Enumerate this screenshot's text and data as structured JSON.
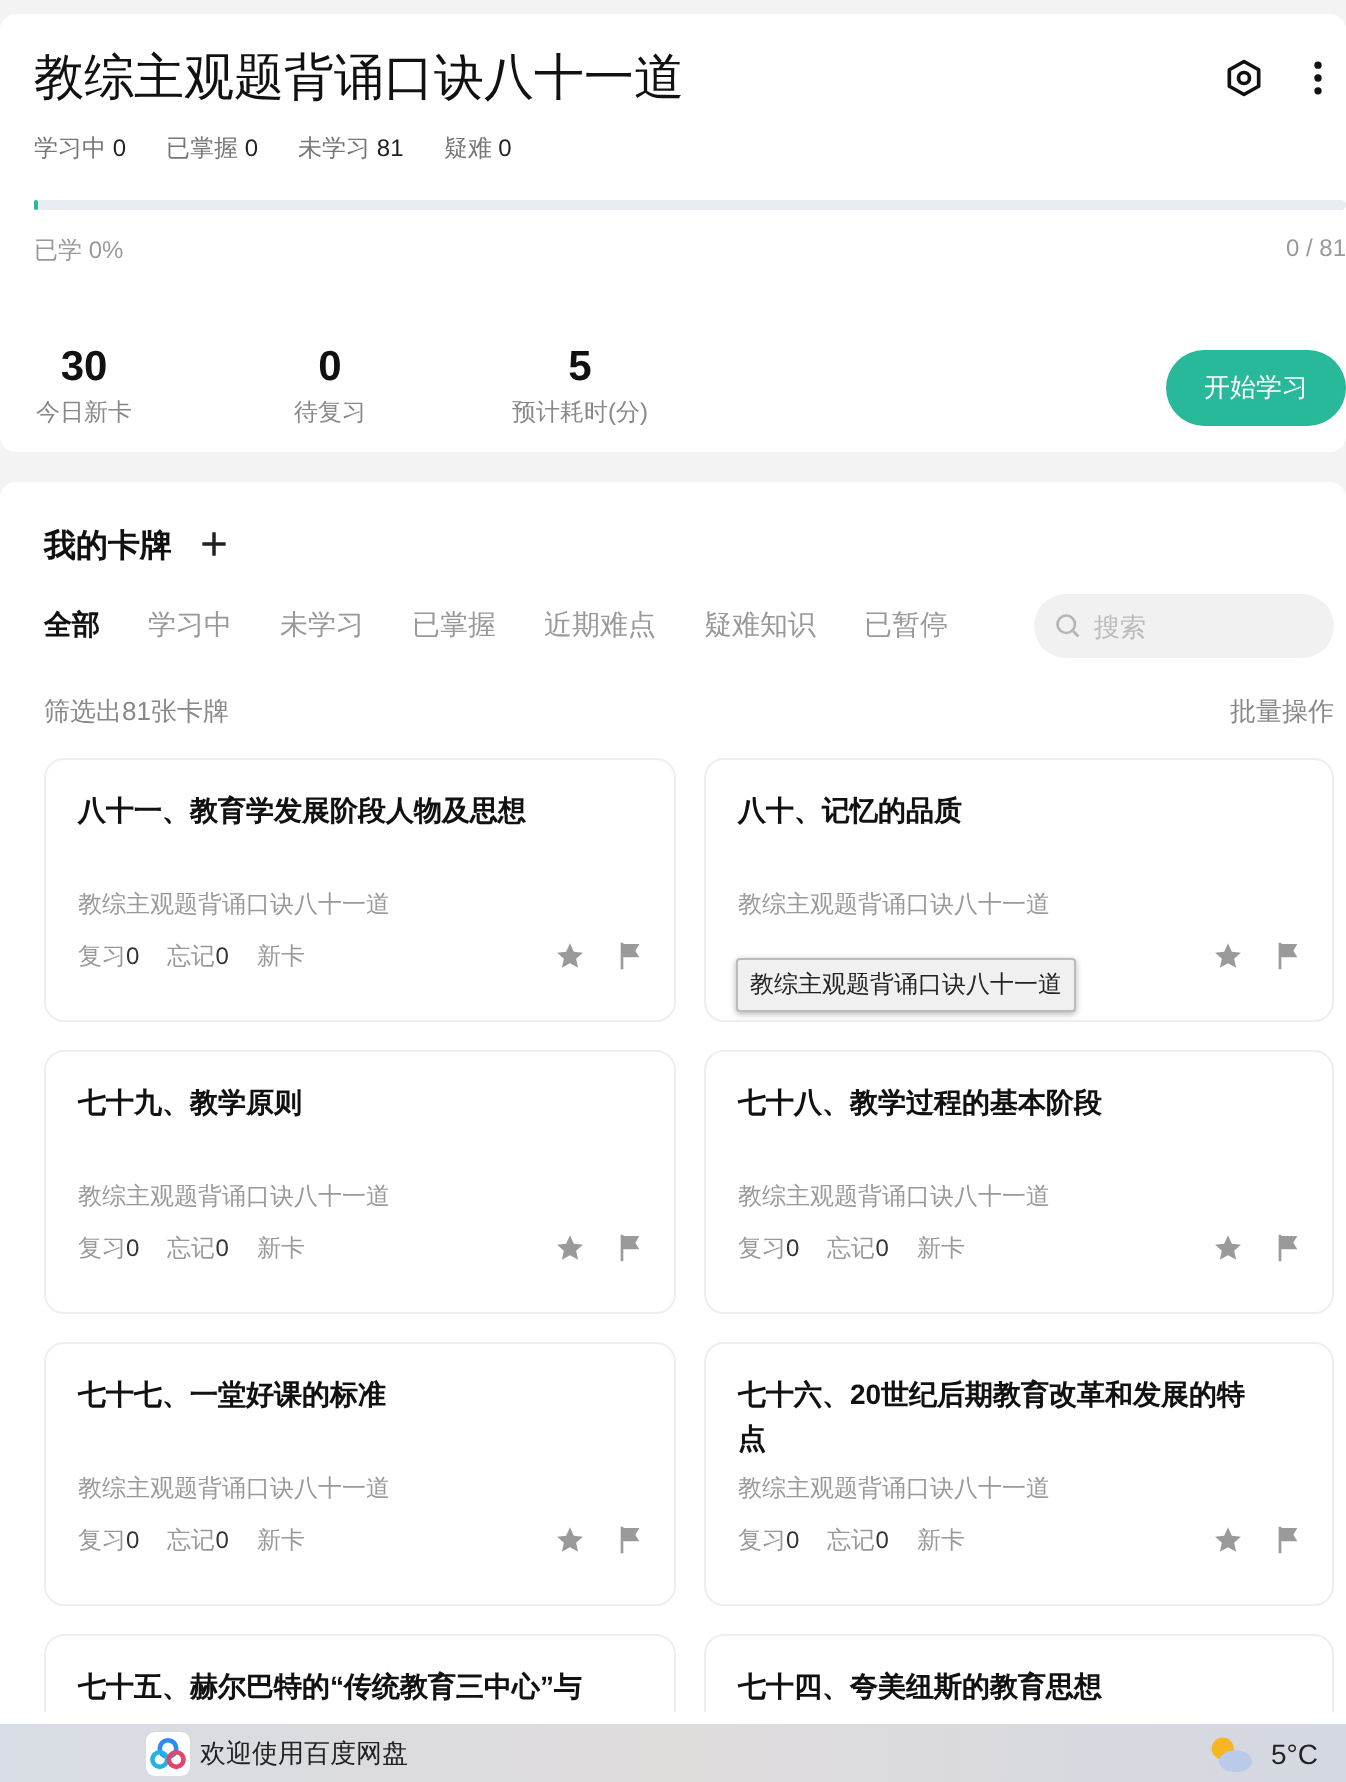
{
  "deck": {
    "title": "教综主观题背诵口诀八十一道",
    "counts": [
      {
        "label": "学习中",
        "value": "0"
      },
      {
        "label": "已掌握",
        "value": "0"
      },
      {
        "label": "未学习",
        "value": "81"
      },
      {
        "label": "疑难",
        "value": "0"
      }
    ],
    "progress": {
      "level": 0,
      "caption": "已学 0%",
      "count": "0 / 81"
    },
    "stats": [
      {
        "value": "30",
        "label": "今日新卡"
      },
      {
        "value": "0",
        "label": "待复习"
      },
      {
        "value": "5",
        "label": "预计耗时(分)"
      }
    ],
    "start_button": "开始学习"
  },
  "cards_section": {
    "title": "我的卡牌",
    "add": "+",
    "tabs": [
      {
        "label": "全部",
        "selected": true
      },
      {
        "label": "学习中",
        "selected": false
      },
      {
        "label": "未学习",
        "selected": false
      },
      {
        "label": "已掌握",
        "selected": false
      },
      {
        "label": "近期难点",
        "selected": false
      },
      {
        "label": "疑难知识",
        "selected": false
      },
      {
        "label": "已暂停",
        "selected": false
      }
    ],
    "search": {
      "placeholder": "搜索"
    },
    "filter_summary": "筛选出81张卡牌",
    "batch_action": "批量操作",
    "cards": [
      {
        "title": "八十一、教育学发展阶段人物及思想",
        "source": "教综主观题背诵口诀八十一道",
        "stats": [
          {
            "label": "复习",
            "value": "0"
          },
          {
            "label": "忘记",
            "value": "0"
          },
          {
            "label": "新卡"
          }
        ]
      },
      {
        "title": "八十、记忆的品质",
        "source": "教综主观题背诵口诀八十一道",
        "tooltip": "教综主观题背诵口诀八十一道"
      },
      {
        "title": "七十九、教学原则",
        "source": "教综主观题背诵口诀八十一道",
        "stats": [
          {
            "label": "复习",
            "value": "0"
          },
          {
            "label": "忘记",
            "value": "0"
          },
          {
            "label": "新卡"
          }
        ]
      },
      {
        "title": "七十八、教学过程的基本阶段",
        "source": "教综主观题背诵口诀八十一道",
        "stats": [
          {
            "label": "复习",
            "value": "0"
          },
          {
            "label": "忘记",
            "value": "0"
          },
          {
            "label": "新卡"
          }
        ]
      },
      {
        "title": "七十七、一堂好课的标准",
        "source": "教综主观题背诵口诀八十一道",
        "stats": [
          {
            "label": "复习",
            "value": "0"
          },
          {
            "label": "忘记",
            "value": "0"
          },
          {
            "label": "新卡"
          }
        ]
      },
      {
        "title": "七十六、20世纪后期教育改革和发展的特点",
        "source": "教综主观题背诵口诀八十一道",
        "stats": [
          {
            "label": "复习",
            "value": "0"
          },
          {
            "label": "忘记",
            "value": "0"
          },
          {
            "label": "新卡"
          }
        ]
      },
      {
        "title": "七十五、赫尔巴特的“传统教育三中心”与"
      },
      {
        "title": "七十四、夸美纽斯的教育思想"
      }
    ]
  },
  "taskbar": {
    "app": "欢迎使用百度网盘",
    "temperature": "5°C"
  }
}
